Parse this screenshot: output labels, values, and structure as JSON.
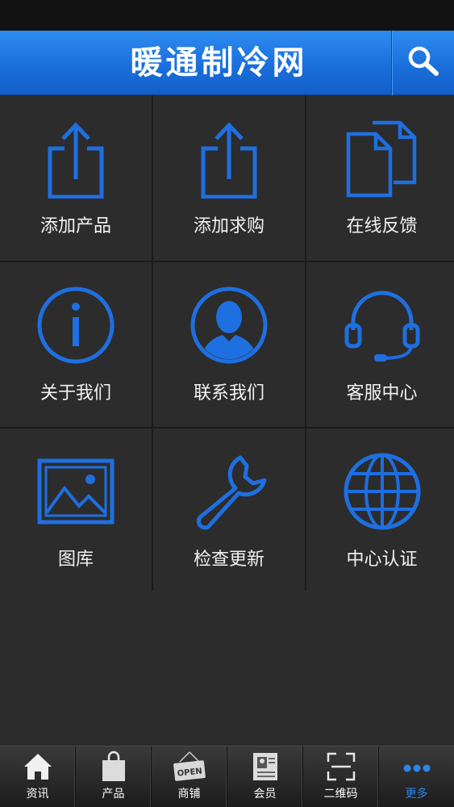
{
  "header": {
    "title": "暖通制冷网"
  },
  "grid": {
    "items": [
      {
        "label": "添加产品",
        "icon": "share-upload-icon"
      },
      {
        "label": "添加求购",
        "icon": "share-upload-icon"
      },
      {
        "label": "在线反馈",
        "icon": "documents-icon"
      },
      {
        "label": "关于我们",
        "icon": "info-icon"
      },
      {
        "label": "联系我们",
        "icon": "user-avatar-icon"
      },
      {
        "label": "客服中心",
        "icon": "headset-icon"
      },
      {
        "label": "图库",
        "icon": "image-gallery-icon"
      },
      {
        "label": "检查更新",
        "icon": "wrench-icon"
      },
      {
        "label": "中心认证",
        "icon": "globe-icon"
      }
    ]
  },
  "tabbar": {
    "items": [
      {
        "label": "资讯",
        "icon": "home-icon"
      },
      {
        "label": "产品",
        "icon": "shopping-bag-icon"
      },
      {
        "label": "商铺",
        "icon": "open-sign-icon",
        "sign_text": "OPEN"
      },
      {
        "label": "会员",
        "icon": "id-card-icon"
      },
      {
        "label": "二维码",
        "icon": "qr-scan-icon"
      },
      {
        "label": "更多",
        "icon": "more-dots-icon",
        "active": true
      }
    ]
  },
  "colors": {
    "accent": "#1e6fe0",
    "header": "#1a6fdc",
    "background": "#2c2c2d",
    "active_tab": "#2a86e8"
  }
}
